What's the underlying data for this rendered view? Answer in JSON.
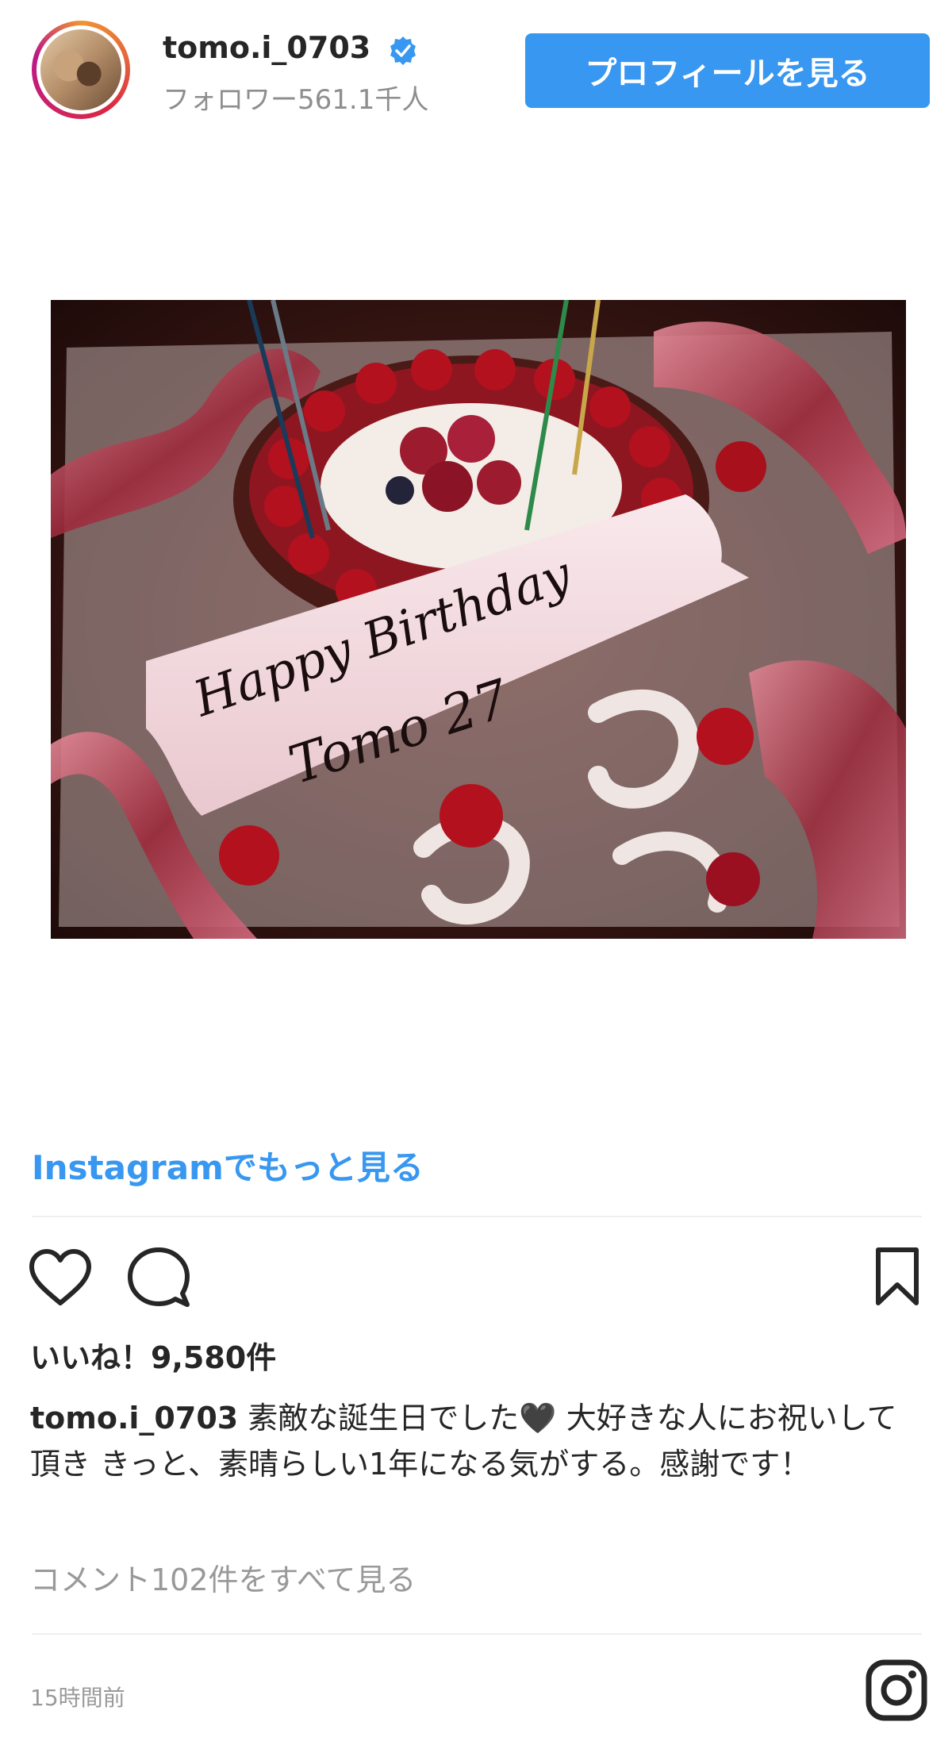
{
  "header": {
    "username": "tomo.i_0703",
    "followers": "フォロワー561.1千人",
    "profile_button": "プロフィールを見る"
  },
  "photo": {
    "cake_text_line1": "Happy Birthday",
    "cake_text_line2": "Tomo 27"
  },
  "more_link": "Instagramでもっと見る",
  "actions": {
    "like_icon": "heart-icon",
    "comment_icon": "comment-icon",
    "save_icon": "bookmark-icon"
  },
  "likes": "いいね！9,580件",
  "caption": {
    "user": "tomo.i_0703",
    "text_part1": " 素敵な誕生日でした",
    "emoji": "🖤",
    "text_part2": " 大好きな人にお祝いして頂き きっと、素晴らしい1年になる気がする。感謝です！"
  },
  "comments_link": "コメント102件をすべて見る",
  "timestamp": "15時間前",
  "colors": {
    "accent": "#3897f0",
    "muted": "#8e8e8e",
    "text": "#262626"
  }
}
